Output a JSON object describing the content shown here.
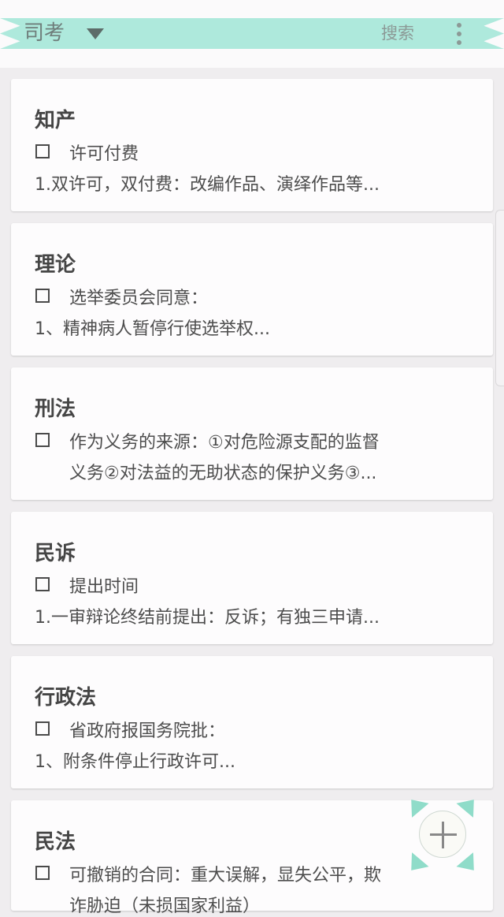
{
  "header": {
    "notebook_title": "司考",
    "search_label": "搜索"
  },
  "notes": [
    {
      "title": "知产",
      "checkbox_item": "许可付费",
      "preview": "1.双许可，双付费：改编作品、演绎作品等..."
    },
    {
      "title": "理论",
      "checkbox_item": "选举委员会同意：",
      "preview": "1、精神病人暂停行使选举权..."
    },
    {
      "title": "刑法",
      "checkbox_item": "作为义务的来源：①对危险源支配的监督",
      "preview": "义务②对法益的无助状态的保护义务③..."
    },
    {
      "title": "民诉",
      "checkbox_item": "提出时间",
      "preview": "1.一审辩论终结前提出：反诉；有独三申请..."
    },
    {
      "title": "行政法",
      "checkbox_item": "省政府报国务院批：",
      "preview": "1、附条件停止行政许可..."
    },
    {
      "title": "民法",
      "checkbox_item": "可撤销的合同：重大误解，显失公平，欺",
      "preview": "诈胁迫（未损国家利益）"
    }
  ],
  "colors": {
    "ribbon": "#aee9dc",
    "background": "#efedef",
    "card": "#fdfcfd"
  },
  "icons": {
    "caret": "dropdown-caret-icon",
    "menu": "more-vert-icon",
    "fab": "plus-icon"
  }
}
